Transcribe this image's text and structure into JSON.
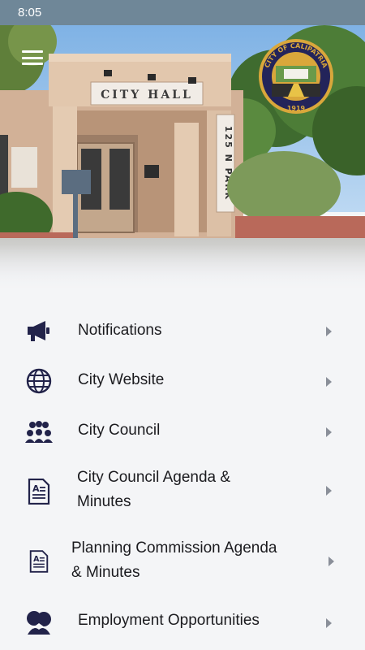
{
  "status_bar": {
    "time": "8:05"
  },
  "hero": {
    "building_sign": "CITY HALL",
    "address_sign": "125 N PARK",
    "seal_text_top": "CITY OF CALIPATRIA",
    "seal_year": "1919"
  },
  "menu": {
    "items": [
      {
        "label": "Notifications",
        "icon": "megaphone-icon"
      },
      {
        "label": "City Website",
        "icon": "globe-icon"
      },
      {
        "label": "City Council",
        "icon": "group-icon"
      },
      {
        "label_line1": "City Council Agenda &",
        "label_line2": "Minutes",
        "icon": "document-icon"
      },
      {
        "label_line1": "Planning Commission Agenda",
        "label_line2": "& Minutes",
        "icon": "document-icon"
      },
      {
        "label": "Employment Opportunities",
        "icon": "handshake-icon"
      }
    ]
  },
  "colors": {
    "icon": "#22234a",
    "status_bar": "#6f8798",
    "seal_gold": "#d9a73b"
  }
}
